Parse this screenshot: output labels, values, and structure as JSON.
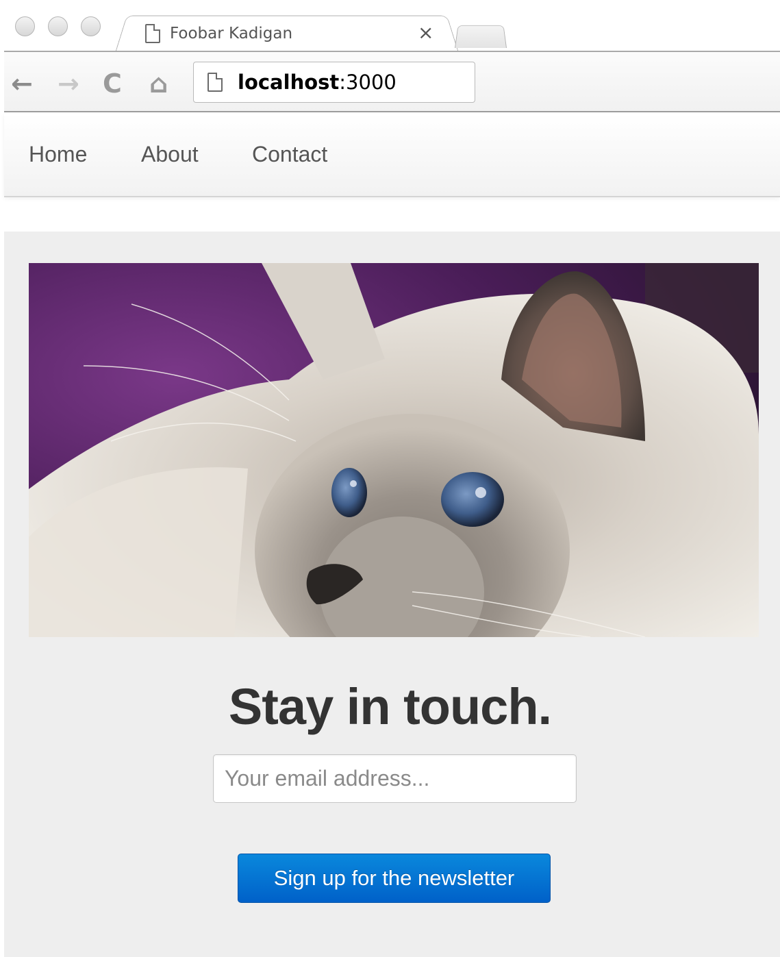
{
  "browser": {
    "tab_title": "Foobar Kadigan",
    "tab_close_glyph": "×",
    "url_host": "localhost",
    "url_port": ":3000",
    "back_glyph": "←",
    "forward_glyph": "→",
    "reload_glyph": "C",
    "home_glyph": "⌂"
  },
  "navbar": {
    "links": [
      {
        "label": "Home"
      },
      {
        "label": "About"
      },
      {
        "label": "Contact"
      }
    ]
  },
  "main": {
    "hero_image": "cat-photo",
    "headline": "Stay in touch.",
    "email_placeholder": "Your email address...",
    "signup_label": "Sign up for the newsletter"
  },
  "colors": {
    "page_bg": "#eeeeee",
    "button_top": "#0a88dc",
    "button_bottom": "#0061c9",
    "hero_backdrop": "#6b2d78"
  }
}
